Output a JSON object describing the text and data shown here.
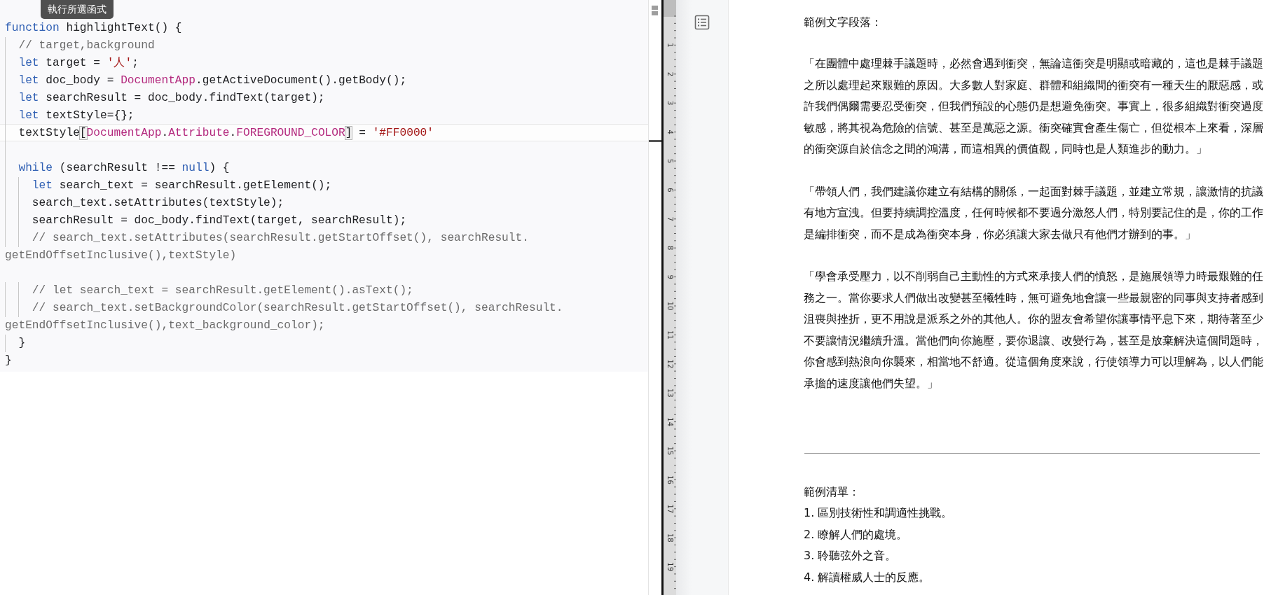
{
  "tooltip": {
    "text": "執行所選函式"
  },
  "editor": {
    "lines": [
      {
        "current": false,
        "tokens": [
          {
            "kind": "keyword",
            "text": "function"
          },
          {
            "kind": "plain",
            "text": " highlightText() {"
          }
        ]
      },
      {
        "current": false,
        "tokens": [
          {
            "kind": "comment",
            "text": "  // target,background"
          }
        ]
      },
      {
        "current": false,
        "tokens": [
          {
            "kind": "keyword",
            "text": "  let"
          },
          {
            "kind": "plain",
            "text": " target = "
          },
          {
            "kind": "string",
            "text": "'人'"
          },
          {
            "kind": "plain",
            "text": ";"
          }
        ]
      },
      {
        "current": false,
        "tokens": [
          {
            "kind": "keyword",
            "text": "  let"
          },
          {
            "kind": "plain",
            "text": " doc_body = "
          },
          {
            "kind": "class",
            "text": "DocumentApp"
          },
          {
            "kind": "plain",
            "text": ".getActiveDocument().getBody();"
          }
        ]
      },
      {
        "current": false,
        "tokens": [
          {
            "kind": "keyword",
            "text": "  let"
          },
          {
            "kind": "plain",
            "text": " searchResult = doc_body.findText(target);"
          }
        ]
      },
      {
        "current": false,
        "tokens": [
          {
            "kind": "keyword",
            "text": "  let"
          },
          {
            "kind": "plain",
            "text": " textStyle={};"
          }
        ]
      },
      {
        "current": true,
        "tokens": [
          {
            "kind": "plain",
            "text": "  textStyle"
          },
          {
            "kind": "bracket",
            "text": "["
          },
          {
            "kind": "class",
            "text": "DocumentApp"
          },
          {
            "kind": "plain",
            "text": "."
          },
          {
            "kind": "class",
            "text": "Attribute"
          },
          {
            "kind": "plain",
            "text": "."
          },
          {
            "kind": "class",
            "text": "FOREGROUND_COLOR"
          },
          {
            "kind": "bracket",
            "text": "]"
          },
          {
            "kind": "plain",
            "text": " = "
          },
          {
            "kind": "string",
            "text": "'#FF0000'"
          }
        ]
      },
      {
        "current": false
      },
      {
        "current": false,
        "tokens": [
          {
            "kind": "keyword",
            "text": "  while"
          },
          {
            "kind": "plain",
            "text": " (searchResult !== "
          },
          {
            "kind": "keyword",
            "text": "null"
          },
          {
            "kind": "plain",
            "text": ") {"
          }
        ]
      },
      {
        "current": false,
        "tokens": [
          {
            "kind": "keyword",
            "text": "    let"
          },
          {
            "kind": "plain",
            "text": " search_text = searchResult.getElement();"
          }
        ]
      },
      {
        "current": false,
        "tokens": [
          {
            "kind": "plain",
            "text": "    search_text.setAttributes(textStyle);"
          }
        ]
      },
      {
        "current": false,
        "tokens": [
          {
            "kind": "plain",
            "text": "    searchResult = doc_body.findText(target, searchResult);"
          }
        ]
      },
      {
        "current": false,
        "tokens": [
          {
            "kind": "comment",
            "text": "    // search_text.setAttributes(searchResult.getStartOffset(), searchResult."
          }
        ]
      },
      {
        "current": false,
        "tokens": [
          {
            "kind": "comment",
            "text": "getEndOffsetInclusive(),textStyle)"
          }
        ]
      },
      {
        "current": false
      },
      {
        "current": false,
        "tokens": [
          {
            "kind": "comment",
            "text": "    // let search_text = searchResult.getElement().asText();"
          }
        ]
      },
      {
        "current": false,
        "tokens": [
          {
            "kind": "comment",
            "text": "    // search_text.setBackgroundColor(searchResult.getStartOffset(), searchResult."
          }
        ]
      },
      {
        "current": false,
        "tokens": [
          {
            "kind": "comment",
            "text": "getEndOffsetInclusive(),text_background_color);"
          }
        ]
      },
      {
        "current": false,
        "tokens": [
          {
            "kind": "plain",
            "text": "  }"
          }
        ]
      },
      {
        "current": false,
        "tokens": [
          {
            "kind": "plain",
            "text": "}"
          }
        ]
      }
    ]
  },
  "ruler": {
    "marks": [
      "1",
      "2",
      "3",
      "4",
      "5",
      "6",
      "7",
      "8",
      "9",
      "10",
      "11",
      "12",
      "13",
      "14",
      "15",
      "16",
      "17",
      "18",
      "19"
    ]
  },
  "document": {
    "heading": "範例文字段落：",
    "paragraphs": [
      {
        "lines": [
          "「在團體中處理棘手議題時，必然會遇到衝突，無論這衝突是明顯或暗藏的，這也是棘手議題",
          "之所以處理起來艱難的原因。大多數人對家庭、群體和組織間的衝突有一種天生的厭惡感，或",
          "許我們偶爾需要忍受衝突，但我們預設的心態仍是想避免衝突。事實上，很多組織對衝突過度",
          "敏感，將其視為危險的信號、甚至是萬惡之源。衝突確實會產生傷亡，但從根本上來看，深層",
          "的衝突源自於信念之間的鴻溝，而這相異的價值觀，同時也是人類進步的動力。」"
        ]
      },
      {
        "lines": [
          "「帶領人們，我們建議你建立有結構的關係，一起面對棘手議題，並建立常規，讓激情的抗議",
          "有地方宣洩。但要持續調控溫度，任何時候都不要過分激怒人們，特別要記住的是，你的工作",
          "是編排衝突，而不是成為衝突本身，你必須讓大家去做只有他們才辦到的事。」"
        ]
      },
      {
        "lines": [
          "「學會承受壓力，以不削弱自己主動性的方式來承接人們的憤怒，是施展領導力時最艱難的任",
          "務之一。當你要求人們做出改變甚至犧牲時，無可避免地會讓一些最親密的同事與支持者感到",
          "沮喪與挫折，更不用說是派系之外的其他人。你的盟友會希望你讓事情平息下來，期待著至少",
          "不要讓情況繼續升溫。當他們向你施壓，要你退讓、改變行為，甚至是放棄解決這個問題時，",
          "你會感到熱浪向你襲來，相當地不舒適。從這個角度來說，行使領導力可以理解為，以人們能",
          "承擔的速度讓他們失望。」"
        ]
      }
    ],
    "list": {
      "title": "範例清單：",
      "items": [
        "1. 區別技術性和調適性挑戰。",
        "2. 瞭解人們的處境。",
        "3. 聆聽弦外之音。",
        "4. 解讀權威人士的反應。"
      ]
    }
  }
}
